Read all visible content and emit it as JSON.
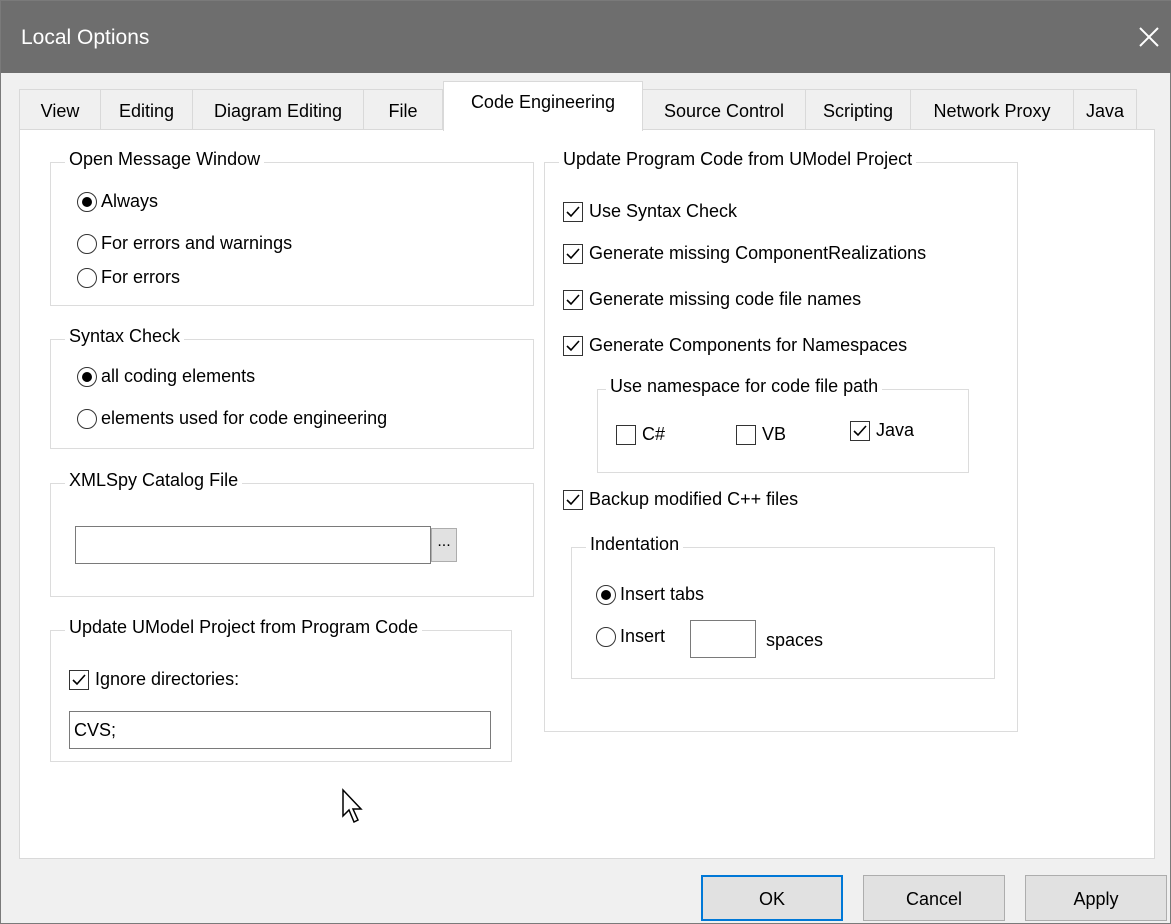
{
  "window": {
    "title": "Local Options"
  },
  "tabs": [
    {
      "label": "View"
    },
    {
      "label": "Editing"
    },
    {
      "label": "Diagram Editing"
    },
    {
      "label": "File"
    },
    {
      "label": "Code Engineering"
    },
    {
      "label": "Source Control"
    },
    {
      "label": "Scripting"
    },
    {
      "label": "Network Proxy"
    },
    {
      "label": "Java"
    }
  ],
  "active_tab": "Code Engineering",
  "open_message_window": {
    "title": "Open Message Window",
    "options": [
      {
        "label": "Always",
        "selected": true
      },
      {
        "label": "For errors and warnings",
        "selected": false
      },
      {
        "label": "For errors",
        "selected": false
      }
    ]
  },
  "syntax_check": {
    "title": "Syntax Check",
    "options": [
      {
        "label": "all coding elements",
        "selected": true
      },
      {
        "label": "elements used for code engineering",
        "selected": false
      }
    ]
  },
  "xmlspy_catalog": {
    "title": "XMLSpy Catalog File",
    "value": "",
    "browse_label": "..."
  },
  "update_umodel": {
    "title": "Update UModel Project from Program Code",
    "ignore_dirs_label": "Ignore directories:",
    "ignore_dirs_checked": true,
    "ignore_dirs_value": "CVS;"
  },
  "update_code": {
    "title": "Update Program Code from UModel Project",
    "use_syntax_check": {
      "label": "Use Syntax Check",
      "checked": true
    },
    "gen_component_realizations": {
      "label": "Generate missing ComponentRealizations",
      "checked": true
    },
    "gen_code_file_names": {
      "label": "Generate missing code file names",
      "checked": true
    },
    "gen_components_namespaces": {
      "label": "Generate Components for Namespaces",
      "checked": true
    },
    "namespace_path": {
      "title": "Use namespace for code file path",
      "csharp": {
        "label": "C#",
        "checked": false
      },
      "vb": {
        "label": "VB",
        "checked": false
      },
      "java": {
        "label": "Java",
        "checked": true
      }
    },
    "backup_cpp": {
      "label": "Backup modified C++ files",
      "checked": true
    },
    "indentation": {
      "title": "Indentation",
      "insert_tabs": {
        "label": "Insert tabs",
        "selected": true
      },
      "insert_spaces": {
        "label": "Insert",
        "selected": false,
        "suffix": "spaces",
        "value": ""
      }
    }
  },
  "buttons": {
    "ok": "OK",
    "cancel": "Cancel",
    "apply": "Apply"
  }
}
